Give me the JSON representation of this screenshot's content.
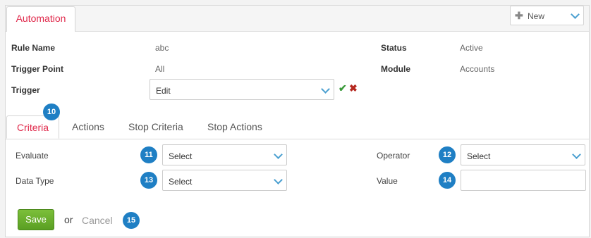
{
  "header": {
    "tab_label": "Automation",
    "new_button_label": "New"
  },
  "rule": {
    "name_label": "Rule Name",
    "name_value": "abc",
    "trigger_point_label": "Trigger Point",
    "trigger_point_value": "All",
    "trigger_label": "Trigger",
    "trigger_value": "Edit",
    "status_label": "Status",
    "status_value": "Active",
    "module_label": "Module",
    "module_value": "Accounts"
  },
  "tabs": [
    {
      "label": "Criteria",
      "active": true
    },
    {
      "label": "Actions",
      "active": false
    },
    {
      "label": "Stop Criteria",
      "active": false
    },
    {
      "label": "Stop Actions",
      "active": false
    }
  ],
  "criteria": {
    "evaluate_label": "Evaluate",
    "evaluate_value": "Select",
    "data_type_label": "Data Type",
    "data_type_value": "Select",
    "operator_label": "Operator",
    "operator_value": "Select",
    "value_label": "Value",
    "value_value": ""
  },
  "badges": [
    "10",
    "11",
    "12",
    "13",
    "14",
    "15"
  ],
  "footer": {
    "save_label": "Save",
    "or_text": "or",
    "cancel_label": "Cancel"
  },
  "colors": {
    "accent": "#e0294b",
    "badge": "#1f7fc4",
    "save": "#6aab2e",
    "chevron": "#4a9fd0"
  }
}
